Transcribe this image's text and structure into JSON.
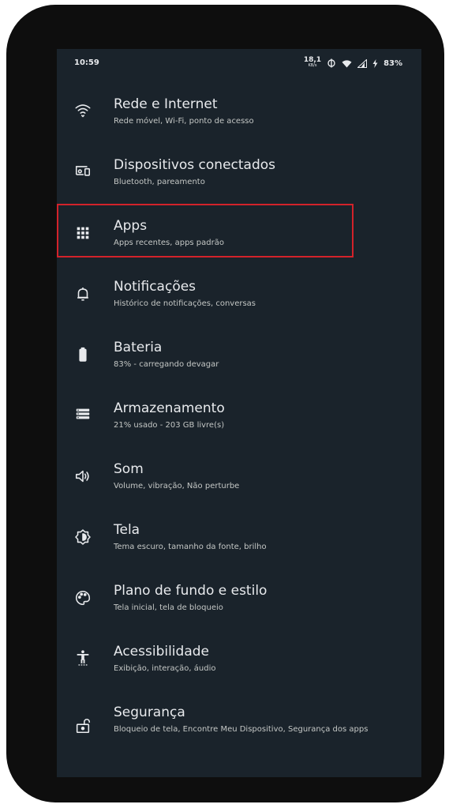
{
  "status_bar": {
    "time": "10:59",
    "net_speed": "18,1",
    "net_unit": "KB/s",
    "battery": "83%",
    "icons": [
      "data-saver-icon",
      "wifi-icon",
      "cell-signal-icon",
      "charging-icon"
    ]
  },
  "settings": [
    {
      "title": "Rede e Internet",
      "subtitle": "Rede móvel, Wi-Fi, ponto de acesso",
      "icon": "wifi-icon"
    },
    {
      "title": "Dispositivos conectados",
      "subtitle": "Bluetooth, pareamento",
      "icon": "connected-devices-icon"
    },
    {
      "title": "Apps",
      "subtitle": "Apps recentes, apps padrão",
      "icon": "apps-grid-icon",
      "highlighted": true
    },
    {
      "title": "Notificações",
      "subtitle": "Histórico de notificações, conversas",
      "icon": "bell-icon"
    },
    {
      "title": "Bateria",
      "subtitle": "83% - carregando devagar",
      "icon": "battery-icon"
    },
    {
      "title": "Armazenamento",
      "subtitle": "21% usado - 203 GB livre(s)",
      "icon": "storage-icon"
    },
    {
      "title": "Som",
      "subtitle": "Volume, vibração, Não perturbe",
      "icon": "speaker-icon"
    },
    {
      "title": "Tela",
      "subtitle": "Tema escuro, tamanho da fonte, brilho",
      "icon": "brightness-icon"
    },
    {
      "title": "Plano de fundo e estilo",
      "subtitle": "Tela inicial, tela de bloqueio",
      "icon": "palette-icon"
    },
    {
      "title": "Acessibilidade",
      "subtitle": "Exibição, interação, áudio",
      "icon": "accessibility-icon"
    },
    {
      "title": "Segurança",
      "subtitle": "Bloqueio de tela, Encontre Meu Dispositivo, Segurança dos apps",
      "icon": "lock-icon"
    }
  ],
  "colors": {
    "screen_bg": "#1a232b",
    "text_primary": "#e8eaed",
    "text_secondary": "#c4c7c5",
    "highlight_border": "#d3222a"
  }
}
